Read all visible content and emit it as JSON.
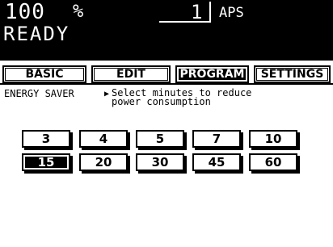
{
  "status": {
    "copies": "100",
    "percent": "%",
    "quantity": "1",
    "paper": "APS",
    "message": "READY"
  },
  "tabs": [
    {
      "label": "BASIC",
      "active": false
    },
    {
      "label": "EDIT",
      "active": false
    },
    {
      "label": "PROGRAM",
      "active": true
    },
    {
      "label": "SETTINGS",
      "active": false
    }
  ],
  "screen": {
    "title": "ENERGY SAVER",
    "description": "Select minutes to reduce\npower consumption"
  },
  "minutes": [
    "3",
    "4",
    "5",
    "7",
    "10",
    "15",
    "20",
    "30",
    "45",
    "60"
  ],
  "selected_minutes": "15"
}
